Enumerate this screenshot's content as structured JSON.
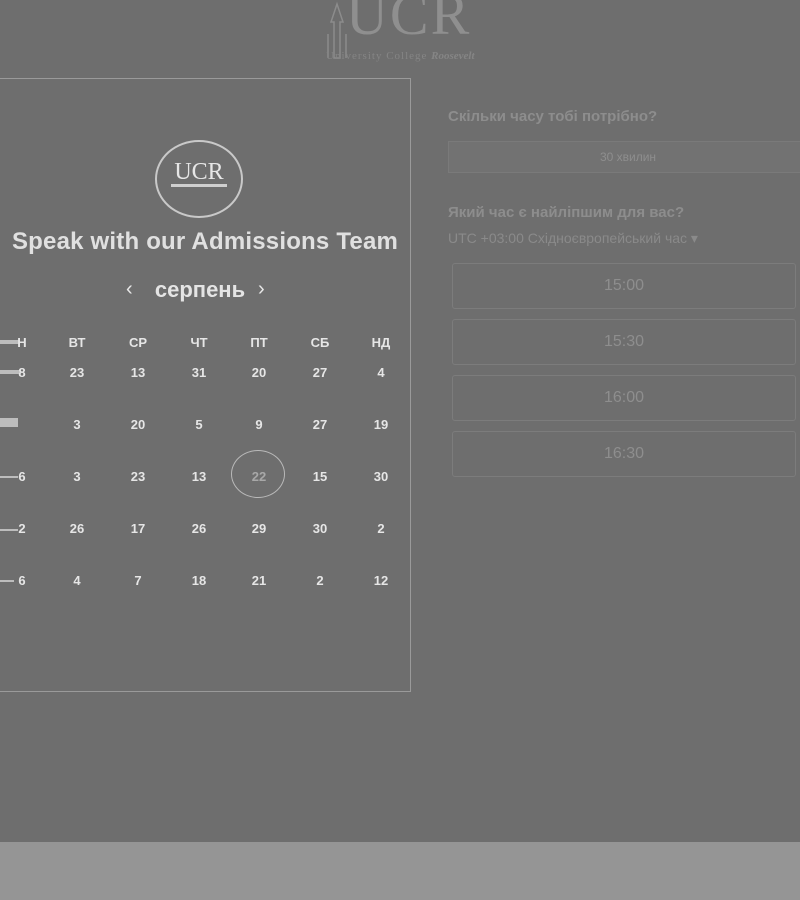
{
  "header": {
    "logo_text": "UCR",
    "logo_subtitle": "University College",
    "logo_subtitle_italic": "Roosevelt"
  },
  "calendar": {
    "badge_text": "UCR",
    "title": "Speak with our Admissions Team",
    "month": "серпень",
    "prev_icon": "‹",
    "next_icon": "›",
    "weekdays": [
      "Н",
      "ВТ",
      "СР",
      "ЧТ",
      "ПТ",
      "СБ",
      "НД"
    ],
    "weeks": [
      [
        "8",
        "23",
        "13",
        "31",
        "20",
        "27",
        "4"
      ],
      [
        "",
        "3",
        "20",
        "5",
        "9",
        "27",
        "19"
      ],
      [
        "6",
        "3",
        "23",
        "13",
        "22",
        "15",
        "30"
      ],
      [
        "2",
        "26",
        "17",
        "26",
        "29",
        "30",
        "2"
      ],
      [
        "6",
        "4",
        "7",
        "18",
        "21",
        "2",
        "12"
      ]
    ],
    "selected_day": "22"
  },
  "scheduler": {
    "duration_question": "Скільки часу тобі потрібно?",
    "duration_value": "30 хвилин",
    "time_question": "Який час є найліпшим для вас?",
    "timezone": "UTC +03:00 Східноєвропейський час ▾",
    "slots": [
      "15:00",
      "15:30",
      "16:00",
      "16:30"
    ]
  },
  "colors": {
    "background": "#6e6e6e",
    "bottom_band": "#959595"
  }
}
